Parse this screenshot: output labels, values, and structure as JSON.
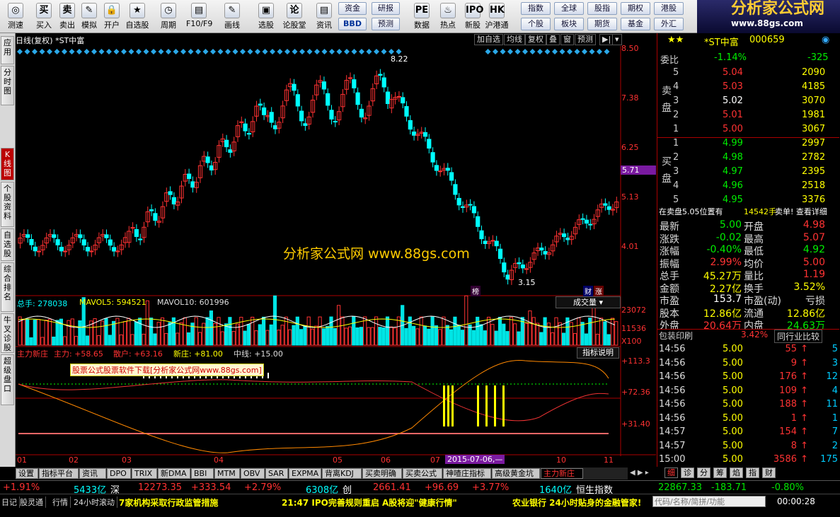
{
  "toolbar": {
    "tools": [
      {
        "label": "测速",
        "icon": "◎"
      },
      {
        "label": "买入",
        "icon": "买"
      },
      {
        "label": "卖出",
        "icon": "卖"
      },
      {
        "label": "模拟",
        "icon": "✎"
      },
      {
        "label": "开户",
        "icon": "🔒"
      },
      {
        "label": "自选股",
        "icon": "★"
      },
      {
        "label": "周期",
        "icon": "◷"
      },
      {
        "label": "F10/F9",
        "icon": "▤"
      },
      {
        "label": "画线",
        "icon": "✎"
      },
      {
        "label": "选股",
        "icon": "▣"
      },
      {
        "label": "论股堂",
        "icon": "论"
      },
      {
        "label": "资讯",
        "icon": "▤"
      },
      {
        "label": "数据",
        "icon": "PE"
      },
      {
        "label": "热点",
        "icon": "♨"
      },
      {
        "label": "新股",
        "icon": "IPO"
      },
      {
        "label": "沪港通",
        "icon": "HK"
      }
    ],
    "buttons": [
      {
        "label": "资金"
      },
      {
        "label": "研报"
      },
      {
        "label": "BBD"
      },
      {
        "label": "预测"
      },
      {
        "label": "指数"
      },
      {
        "label": "全球"
      },
      {
        "label": "股指"
      },
      {
        "label": "期权"
      },
      {
        "label": "港股"
      },
      {
        "label": "个股"
      },
      {
        "label": "板块"
      },
      {
        "label": "期货"
      },
      {
        "label": "基金"
      },
      {
        "label": "外汇"
      }
    ],
    "logo_title": "分析家公式网",
    "logo_url": "www.88gs.com"
  },
  "sidebar": [
    {
      "label": "应用"
    },
    {
      "label": "分时图"
    },
    {
      "label": "K线图"
    },
    {
      "label": "个股资料"
    },
    {
      "label": "自选股"
    },
    {
      "label": "综合排名"
    },
    {
      "label": "牛叉诊股"
    },
    {
      "label": "超级盘口"
    }
  ],
  "chart": {
    "title": "日线(复权) *ST中富",
    "top_buttons": [
      "加自选",
      "均线",
      "复权",
      "叠",
      "窗",
      "预测"
    ],
    "watermark": "分析家公式网   www.88gs.com",
    "high_label": "8.22",
    "low_label": "3.15",
    "price_ticks": [
      "8.50",
      "7.38",
      "6.25",
      "5.13",
      "4.01"
    ],
    "current_price": "5.71",
    "badge_bang": "榜",
    "badge_cai": "财",
    "badge_zhang": "涨",
    "vol_header": {
      "total": "总手: 278038",
      "ma5": "MAVOL5: 594521",
      "ma10": "MAVOL10: 601996"
    },
    "vol_select": "成交量",
    "vol_ticks": [
      "23072",
      "11536",
      "X100"
    ],
    "ind_header": {
      "name": "主力新庄",
      "zl": "主力: +58.65",
      "sh": "散户: +63.16",
      "xz": "新庄: +81.00",
      "zx": "中线: +15.00"
    },
    "ind_button": "指标说明",
    "ind_ticks": [
      "+113.3",
      "+72.36",
      "+31.40"
    ],
    "ad_text": "股票公式股票软件下载[分析家公式网www.88gs.com]",
    "months": [
      "01",
      "02",
      "03",
      "04",
      "05",
      "06",
      "07",
      "10",
      "11"
    ],
    "date_cursor": "2015-07-06,—"
  },
  "chart_data": {
    "type": "candlestick",
    "ylim": [
      3.0,
      8.5
    ],
    "high": 8.22,
    "low": 3.15
  },
  "quote": {
    "name": "*ST中富",
    "code": "000659",
    "weibi": "委比",
    "weibi_pct": "-1.14%",
    "weibi_val": "-325",
    "sell_label": "卖盘",
    "buy_label": "买盘",
    "asks": [
      {
        "lvl": "5",
        "price": "5.04",
        "vol": "2090"
      },
      {
        "lvl": "4",
        "price": "5.03",
        "vol": "4185"
      },
      {
        "lvl": "3",
        "price": "5.02",
        "vol": "3070"
      },
      {
        "lvl": "2",
        "price": "5.01",
        "vol": "1981"
      },
      {
        "lvl": "1",
        "price": "5.00",
        "vol": "3067"
      }
    ],
    "bids": [
      {
        "lvl": "1",
        "price": "4.99",
        "vol": "2997"
      },
      {
        "lvl": "2",
        "price": "4.98",
        "vol": "2782"
      },
      {
        "lvl": "3",
        "price": "4.97",
        "vol": "2395"
      },
      {
        "lvl": "4",
        "price": "4.96",
        "vol": "2518"
      },
      {
        "lvl": "5",
        "price": "4.95",
        "vol": "3376"
      }
    ],
    "notice_a": "在卖盘5.05位置有",
    "notice_b": "14542手",
    "notice_c": "卖单! 查看详细",
    "stats": [
      {
        "k1": "最新",
        "v1": "5.00",
        "k2": "开盘",
        "v2": "4.98"
      },
      {
        "k1": "涨跌",
        "v1": "-0.02",
        "k2": "最高",
        "v2": "5.07"
      },
      {
        "k1": "涨幅",
        "v1": "-0.40%",
        "k2": "最低",
        "v2": "4.92"
      },
      {
        "k1": "振幅",
        "v1": "2.99%",
        "k2": "均价",
        "v2": "5.00"
      },
      {
        "k1": "总手",
        "v1": "45.27万",
        "k2": "量比",
        "v2": "1.19"
      },
      {
        "k1": "金额",
        "v1": "2.27亿",
        "k2": "换手",
        "v2": "3.52%"
      },
      {
        "k1": "市盈",
        "v1": "153.7",
        "k2": "市盈(动)",
        "v2": "亏损"
      },
      {
        "k1": "股本",
        "v1": "12.86亿",
        "k2": "流通",
        "v2": "12.86亿"
      },
      {
        "k1": "外盘",
        "v1": "20.64万",
        "k2": "内盘",
        "v2": "24.63万"
      }
    ],
    "industry": "包装印刷",
    "industry_pct": "3.42%",
    "industry_btn": "同行业比较",
    "ticks": [
      {
        "t": "14:56",
        "p": "5.00",
        "v": "55",
        "n": "5"
      },
      {
        "t": "14:56",
        "p": "5.00",
        "v": "9",
        "n": "3"
      },
      {
        "t": "14:56",
        "p": "5.00",
        "v": "176",
        "n": "12"
      },
      {
        "t": "14:56",
        "p": "5.00",
        "v": "109",
        "n": "4"
      },
      {
        "t": "14:56",
        "p": "5.00",
        "v": "188",
        "n": "11"
      },
      {
        "t": "14:56",
        "p": "5.00",
        "v": "1",
        "n": "1"
      },
      {
        "t": "14:57",
        "p": "5.00",
        "v": "154",
        "n": "7"
      },
      {
        "t": "14:57",
        "p": "5.00",
        "v": "8",
        "n": "2"
      },
      {
        "t": "15:00",
        "p": "5.00",
        "v": "3586",
        "n": "175"
      }
    ],
    "right_tabs": [
      "细",
      "诊",
      "分",
      "筹",
      "焰",
      "指",
      "财"
    ]
  },
  "bottom_tabs": [
    "设置",
    "指标平台",
    "资讯",
    "DPO",
    "TRIX",
    "新DMA",
    "BBI",
    "MTM",
    "OBV",
    "SAR",
    "EXPMA",
    "背离KDJ",
    "买卖明确",
    "买卖公式",
    "神喳庄指标",
    "高级黄金坑",
    "主力新庄"
  ],
  "statusbar": {
    "sh_pct": "+1.91%",
    "sh_amt": "5433亿",
    "sz": "深",
    "sz_idx": "12273.35",
    "sz_chg": "+333.54",
    "sz_pct": "+2.79%",
    "cy_amt": "6308亿",
    "cy": "创",
    "cy_idx": "2661.41",
    "cy_chg": "+96.69",
    "cy_pct": "+3.77%",
    "hs_amt": "1640亿",
    "hs": "恒生指数",
    "hs_idx": "22867.33",
    "hs_chg": "-183.71",
    "hs_pct": "-0.80%"
  },
  "newsbar": {
    "items": [
      "日记",
      "股灵通",
      "行情",
      "24小时滚动"
    ],
    "news1": "7家机构采取行政监管措施",
    "news2": "21:47 IPO完善规则重启 A股将迎\"健康行情\"",
    "news3": "农业银行 24小时贴身的金融管家!",
    "search_placeholder": "代码/名称/简拼/功能",
    "clock": "00:00:28"
  }
}
